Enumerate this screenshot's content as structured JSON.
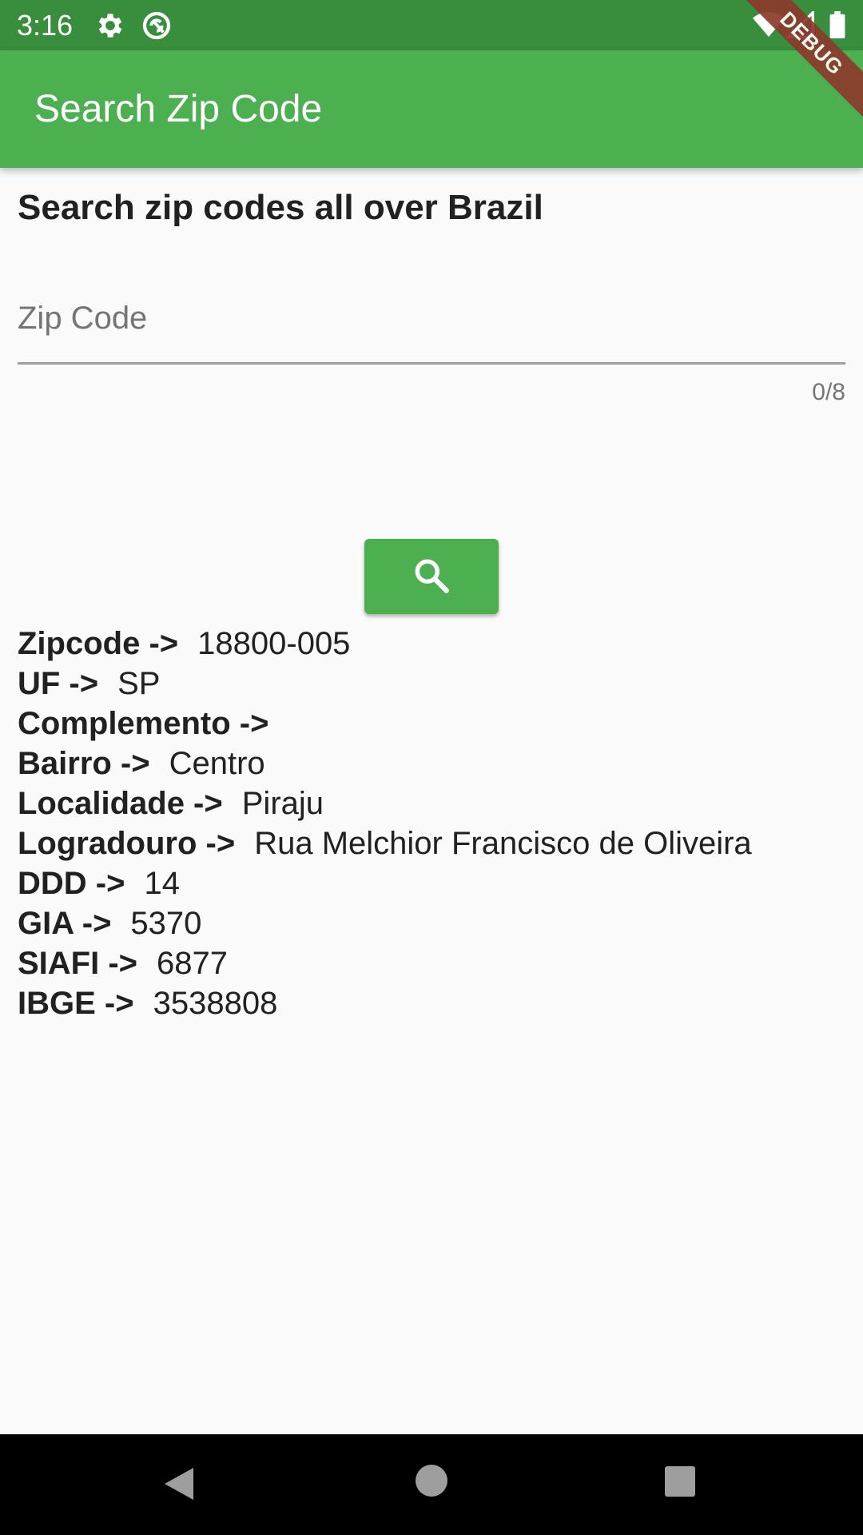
{
  "status_bar": {
    "time": "3:16",
    "icons": [
      "gear-icon",
      "sync-icon",
      "wifi-icon",
      "signal-icon",
      "battery-icon"
    ]
  },
  "debug_banner": "DEBUG",
  "app_bar": {
    "title": "Search Zip Code"
  },
  "main": {
    "heading": "Search zip codes all over Brazil",
    "zip_input": {
      "placeholder": "Zip Code",
      "value": "",
      "counter": "0/8"
    },
    "search_button": {
      "icon": "search-icon"
    }
  },
  "results": [
    {
      "label": "Zipcode ->",
      "value": "18800-005"
    },
    {
      "label": "UF ->",
      "value": "SP"
    },
    {
      "label": "Complemento ->",
      "value": ""
    },
    {
      "label": "Bairro ->",
      "value": "Centro"
    },
    {
      "label": "Localidade ->",
      "value": "Piraju"
    },
    {
      "label": "Logradouro ->",
      "value": "Rua Melchior Francisco de Oliveira"
    },
    {
      "label": "DDD ->",
      "value": "14"
    },
    {
      "label": "GIA ->",
      "value": "5370"
    },
    {
      "label": "SIAFI ->",
      "value": "6877"
    },
    {
      "label": "IBGE ->",
      "value": "3538808"
    }
  ],
  "colors": {
    "status_bar": "#388e3c",
    "app_bar": "#4caf50",
    "button": "#4caf50",
    "background": "#fafafa",
    "nav_bar": "#000000"
  }
}
